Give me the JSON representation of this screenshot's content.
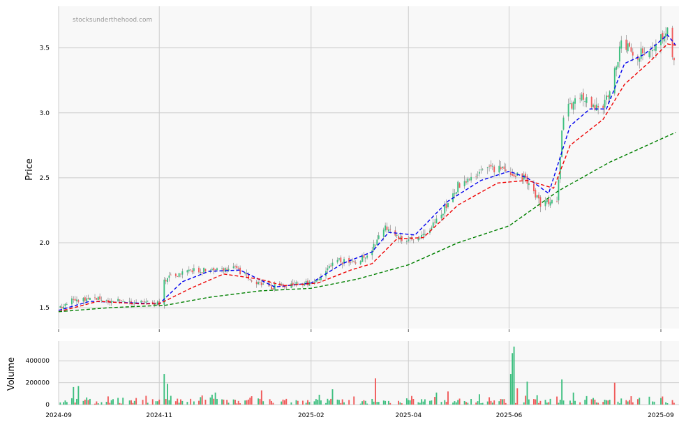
{
  "watermark": "stocksunderthehood.com",
  "colors": {
    "up": "#3dbf7f",
    "down": "#f05a5a",
    "ma_short": "#0000ee",
    "ma_mid": "#ee0000",
    "ma_long": "#008000",
    "panel_bg": "#f8f8f8",
    "grid": "#cccccc"
  },
  "chart_data": [
    {
      "type": "candlestick",
      "ylabel": "Price",
      "ylim": [
        1.34,
        3.82
      ],
      "yticks": [
        "1.5",
        "2.0",
        "2.5",
        "3.0",
        "3.5"
      ],
      "x_range": [
        "2024-09-01",
        "2025-09-12"
      ],
      "xticks": [
        "2024-09",
        "2024-11",
        "2025-02",
        "2025-04",
        "2025-06",
        "2025-09"
      ],
      "grid": true,
      "close_path": [
        [
          "2024-09-01",
          1.5
        ],
        [
          "2024-09-10",
          1.56
        ],
        [
          "2024-09-22",
          1.58
        ],
        [
          "2024-10-05",
          1.55
        ],
        [
          "2024-10-20",
          1.54
        ],
        [
          "2024-11-01",
          1.53
        ],
        [
          "2024-11-04",
          1.72
        ],
        [
          "2024-11-20",
          1.78
        ],
        [
          "2024-12-05",
          1.8
        ],
        [
          "2024-12-18",
          1.8
        ],
        [
          "2024-12-28",
          1.7
        ],
        [
          "2025-01-08",
          1.66
        ],
        [
          "2025-01-25",
          1.68
        ],
        [
          "2025-02-05",
          1.7
        ],
        [
          "2025-02-15",
          1.86
        ],
        [
          "2025-03-01",
          1.85
        ],
        [
          "2025-03-10",
          1.95
        ],
        [
          "2025-03-17",
          2.12
        ],
        [
          "2025-03-28",
          2.02
        ],
        [
          "2025-04-08",
          2.02
        ],
        [
          "2025-04-22",
          2.25
        ],
        [
          "2025-05-01",
          2.44
        ],
        [
          "2025-05-20",
          2.58
        ],
        [
          "2025-06-01",
          2.55
        ],
        [
          "2025-06-10",
          2.5
        ],
        [
          "2025-06-20",
          2.3
        ],
        [
          "2025-06-30",
          2.32
        ],
        [
          "2025-07-04",
          3.0
        ],
        [
          "2025-07-15",
          3.12
        ],
        [
          "2025-07-28",
          3.02
        ],
        [
          "2025-08-08",
          3.52
        ],
        [
          "2025-08-18",
          3.45
        ],
        [
          "2025-08-28",
          3.52
        ],
        [
          "2025-09-05",
          3.62
        ],
        [
          "2025-09-07",
          3.5
        ],
        [
          "2025-09-09",
          3.38
        ]
      ],
      "series": [
        {
          "name": "",
          "color_key": "ma_short",
          "dash": "dashed",
          "points": [
            [
              "2024-09-01",
              1.48
            ],
            [
              "2024-09-20",
              1.55
            ],
            [
              "2024-10-10",
              1.54
            ],
            [
              "2024-11-01",
              1.53
            ],
            [
              "2024-11-15",
              1.7
            ],
            [
              "2024-12-01",
              1.78
            ],
            [
              "2024-12-20",
              1.79
            ],
            [
              "2025-01-10",
              1.66
            ],
            [
              "2025-02-01",
              1.69
            ],
            [
              "2025-02-20",
              1.84
            ],
            [
              "2025-03-10",
              1.93
            ],
            [
              "2025-03-20",
              2.08
            ],
            [
              "2025-04-05",
              2.06
            ],
            [
              "2025-04-25",
              2.32
            ],
            [
              "2025-05-15",
              2.48
            ],
            [
              "2025-06-01",
              2.55
            ],
            [
              "2025-06-12",
              2.5
            ],
            [
              "2025-06-25",
              2.38
            ],
            [
              "2025-07-08",
              2.9
            ],
            [
              "2025-07-20",
              3.03
            ],
            [
              "2025-07-30",
              3.03
            ],
            [
              "2025-08-10",
              3.38
            ],
            [
              "2025-08-22",
              3.45
            ],
            [
              "2025-09-05",
              3.6
            ],
            [
              "2025-09-10",
              3.52
            ]
          ]
        },
        {
          "name": "",
          "color_key": "ma_mid",
          "dash": "dashed",
          "points": [
            [
              "2024-09-01",
              1.47
            ],
            [
              "2024-09-25",
              1.55
            ],
            [
              "2024-10-20",
              1.53
            ],
            [
              "2024-11-01",
              1.53
            ],
            [
              "2024-11-20",
              1.65
            ],
            [
              "2024-12-10",
              1.76
            ],
            [
              "2025-01-01",
              1.72
            ],
            [
              "2025-01-15",
              1.67
            ],
            [
              "2025-02-05",
              1.69
            ],
            [
              "2025-02-25",
              1.79
            ],
            [
              "2025-03-10",
              1.84
            ],
            [
              "2025-03-25",
              2.03
            ],
            [
              "2025-04-10",
              2.04
            ],
            [
              "2025-05-01",
              2.29
            ],
            [
              "2025-05-25",
              2.46
            ],
            [
              "2025-06-12",
              2.48
            ],
            [
              "2025-06-28",
              2.42
            ],
            [
              "2025-07-08",
              2.75
            ],
            [
              "2025-07-28",
              2.95
            ],
            [
              "2025-08-10",
              3.22
            ],
            [
              "2025-08-25",
              3.39
            ],
            [
              "2025-09-05",
              3.53
            ],
            [
              "2025-09-10",
              3.52
            ]
          ]
        },
        {
          "name": "",
          "color_key": "ma_long",
          "dash": "dashed",
          "points": [
            [
              "2024-09-01",
              1.47
            ],
            [
              "2024-10-01",
              1.5
            ],
            [
              "2024-11-05",
              1.52
            ],
            [
              "2024-12-01",
              1.58
            ],
            [
              "2025-01-01",
              1.63
            ],
            [
              "2025-02-01",
              1.65
            ],
            [
              "2025-03-01",
              1.72
            ],
            [
              "2025-04-01",
              1.83
            ],
            [
              "2025-05-01",
              2.0
            ],
            [
              "2025-06-01",
              2.13
            ],
            [
              "2025-07-01",
              2.4
            ],
            [
              "2025-08-01",
              2.62
            ],
            [
              "2025-09-10",
              2.85
            ]
          ]
        }
      ]
    },
    {
      "type": "bar",
      "ylabel": "Volume",
      "ylim": [
        0,
        580000
      ],
      "yticks": [
        "0",
        "200000",
        "400000"
      ],
      "x_range": [
        "2024-09-01",
        "2025-09-12"
      ],
      "xticks": [
        "2024-09",
        "2024-11",
        "2025-02",
        "2025-04",
        "2025-06",
        "2025-09"
      ],
      "grid": true,
      "spikes": [
        [
          "2024-09-10",
          160000,
          "up"
        ],
        [
          "2024-09-13",
          170000,
          "up"
        ],
        [
          "2024-09-28",
          80000,
          "down"
        ],
        [
          "2024-10-18",
          60000,
          "down"
        ],
        [
          "2024-10-24",
          80000,
          "down"
        ],
        [
          "2024-10-26",
          140000,
          "up"
        ],
        [
          "2024-11-04",
          280000,
          "up"
        ],
        [
          "2024-11-06",
          190000,
          "up"
        ],
        [
          "2024-11-08",
          80000,
          "up"
        ],
        [
          "2024-12-05",
          110000,
          "up"
        ],
        [
          "2025-01-02",
          130000,
          "down"
        ],
        [
          "2025-02-01",
          150000,
          "up"
        ],
        [
          "2025-02-06",
          90000,
          "up"
        ],
        [
          "2025-02-14",
          140000,
          "up"
        ],
        [
          "2025-03-02",
          140000,
          "up"
        ],
        [
          "2025-03-12",
          240000,
          "down"
        ],
        [
          "2025-03-15",
          100000,
          "up"
        ],
        [
          "2025-04-06",
          70000,
          "down"
        ],
        [
          "2025-04-12",
          160000,
          "up"
        ],
        [
          "2025-04-18",
          110000,
          "up"
        ],
        [
          "2025-04-25",
          120000,
          "down"
        ],
        [
          "2025-06-02",
          280000,
          "up"
        ],
        [
          "2025-06-03",
          470000,
          "up"
        ],
        [
          "2025-06-04",
          530000,
          "up"
        ],
        [
          "2025-06-06",
          150000,
          "down"
        ],
        [
          "2025-06-12",
          210000,
          "up"
        ],
        [
          "2025-07-03",
          230000,
          "up"
        ],
        [
          "2025-07-06",
          260000,
          "down"
        ],
        [
          "2025-07-10",
          110000,
          "up"
        ],
        [
          "2025-07-20",
          160000,
          "down"
        ],
        [
          "2025-08-04",
          200000,
          "down"
        ],
        [
          "2025-08-10",
          110000,
          "up"
        ],
        [
          "2025-09-01",
          60000,
          "up"
        ]
      ]
    }
  ]
}
